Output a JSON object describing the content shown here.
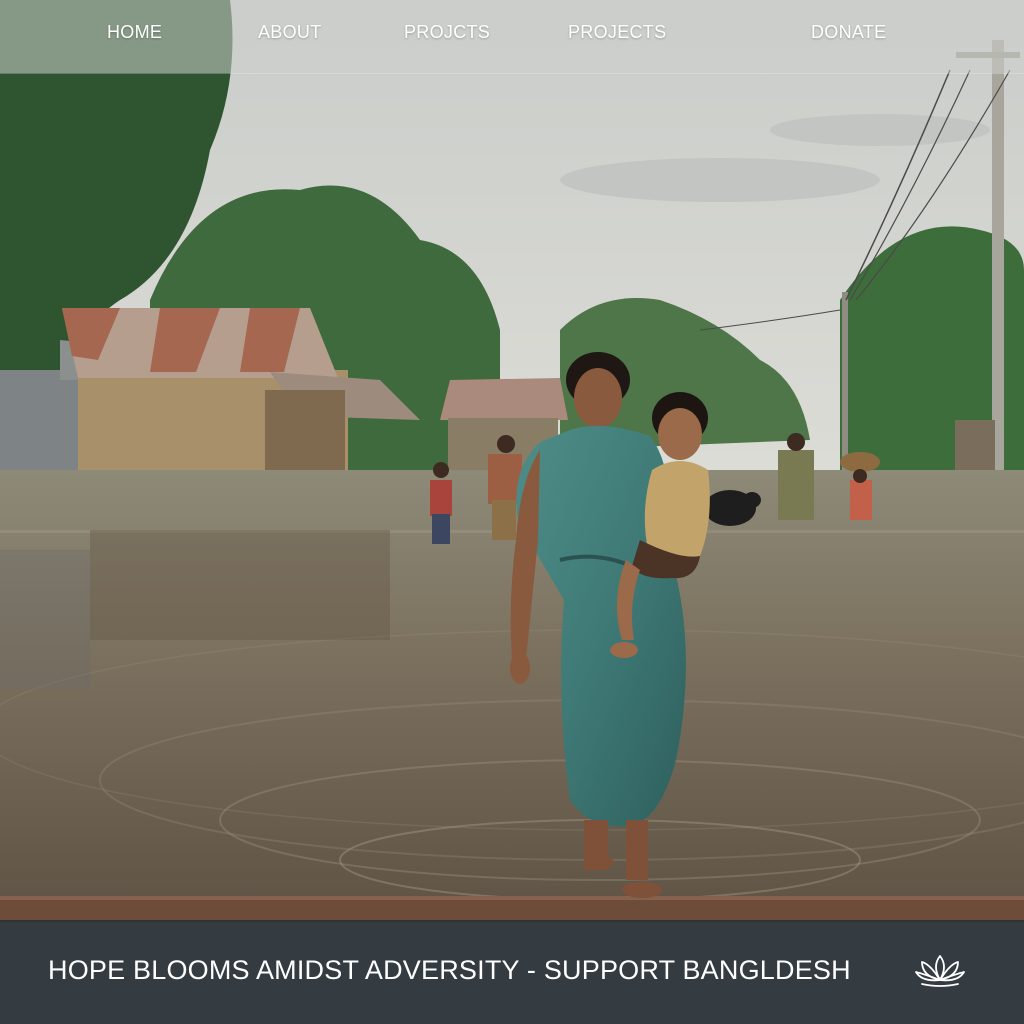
{
  "nav": {
    "items": [
      {
        "label": "HOME"
      },
      {
        "label": "ABOUT"
      },
      {
        "label": "PROJCTS"
      },
      {
        "label": "PROJECTS"
      },
      {
        "label": "DONATE"
      }
    ]
  },
  "banner": {
    "text": "HOPE BLOOMS AMIDST ADVERSITY - SUPPORT BANGLDESH",
    "icon": "lotus-icon"
  },
  "hero": {
    "icon": "flooded-village-photo"
  },
  "colors": {
    "nav_bg": "#cdd0ce",
    "banner_bg": "#283038",
    "text": "#ffffff"
  }
}
